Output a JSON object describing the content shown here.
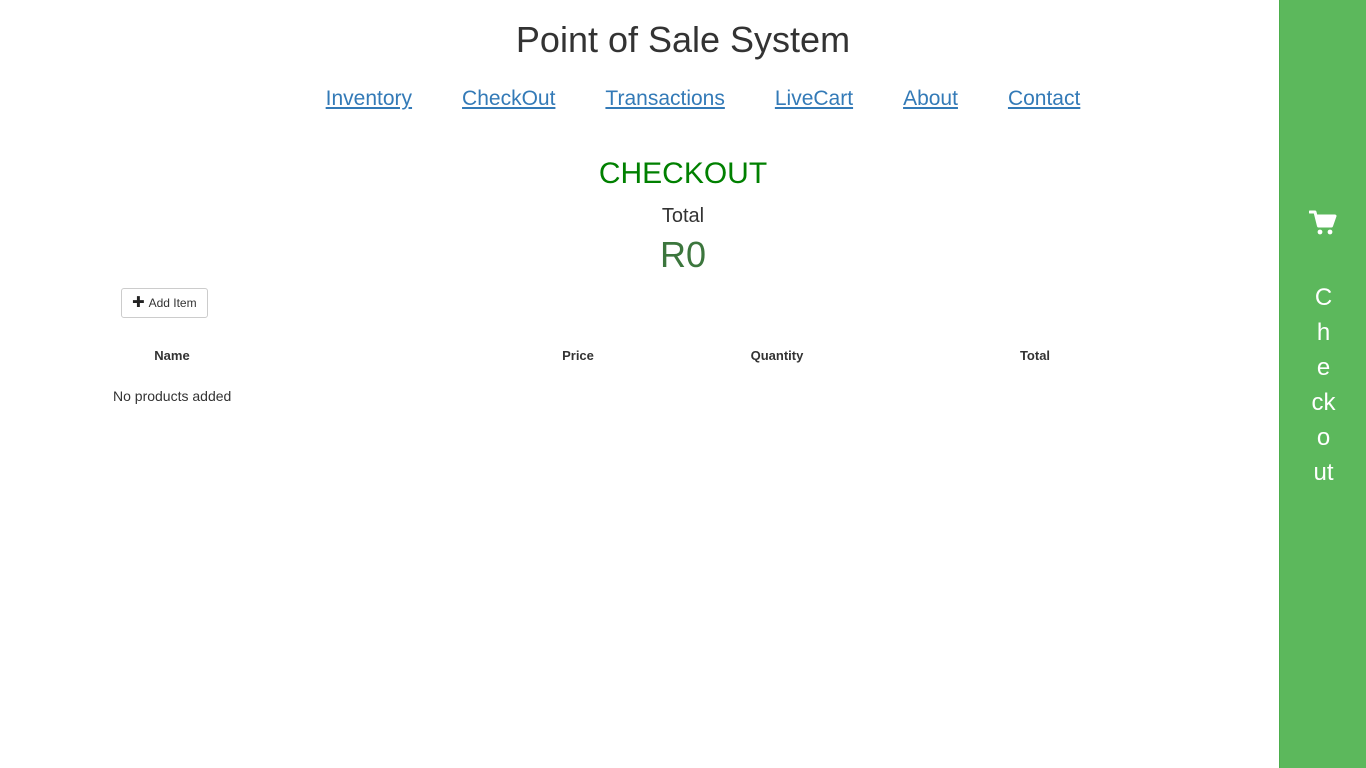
{
  "header": {
    "title": "Point of Sale System"
  },
  "nav": {
    "items": [
      {
        "label": "Inventory"
      },
      {
        "label": "CheckOut"
      },
      {
        "label": "Transactions"
      },
      {
        "label": "LiveCart"
      },
      {
        "label": "About"
      },
      {
        "label": "Contact"
      }
    ]
  },
  "checkout": {
    "heading": "CHECKOUT",
    "total_label": "Total",
    "total_value": "R0",
    "add_item_label": "Add Item",
    "add_item_icon": "plus-icon",
    "table": {
      "columns": [
        "Name",
        "Price",
        "Quantity",
        "Total"
      ],
      "empty_message": "No products added"
    }
  },
  "sidebar": {
    "icon": "shopping-cart-icon",
    "label": "Checkout",
    "color": "#5cb85c"
  },
  "colors": {
    "heading_green": "#008000",
    "total_green": "#3c763d",
    "link_blue": "#337ab7"
  }
}
